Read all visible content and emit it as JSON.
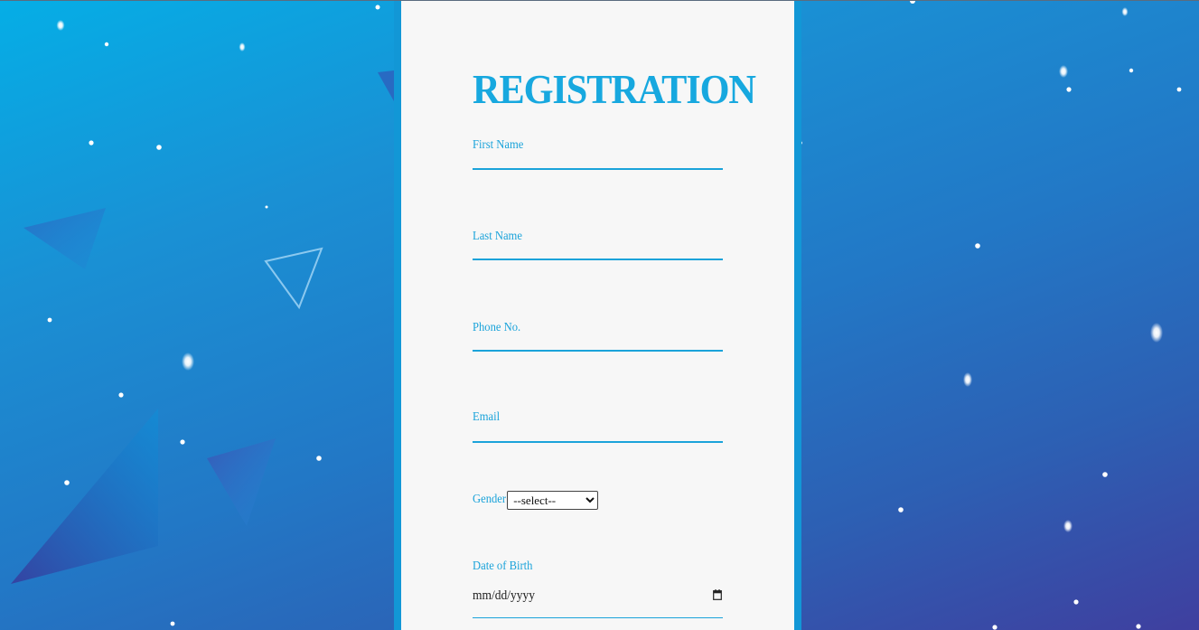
{
  "form": {
    "title": "REGISTRATION",
    "fields": {
      "first_name": {
        "label": "First Name"
      },
      "last_name": {
        "label": "Last Name"
      },
      "phone": {
        "label": "Phone No."
      },
      "email": {
        "label": "Email"
      },
      "gender": {
        "label": "Gender",
        "selected": "--select--"
      },
      "dob": {
        "label": "Date of Birth",
        "value": "mm/dd/yyyy"
      }
    }
  },
  "icons": {
    "dropdown": "chevron-down-icon",
    "calendar": "calendar-icon"
  },
  "colors": {
    "accent": "#1ba3da",
    "panel_background": "#f7f7f7",
    "panel_frame": "#1297d6",
    "background_start": "#05aee6",
    "background_end": "#3f3f9f"
  }
}
